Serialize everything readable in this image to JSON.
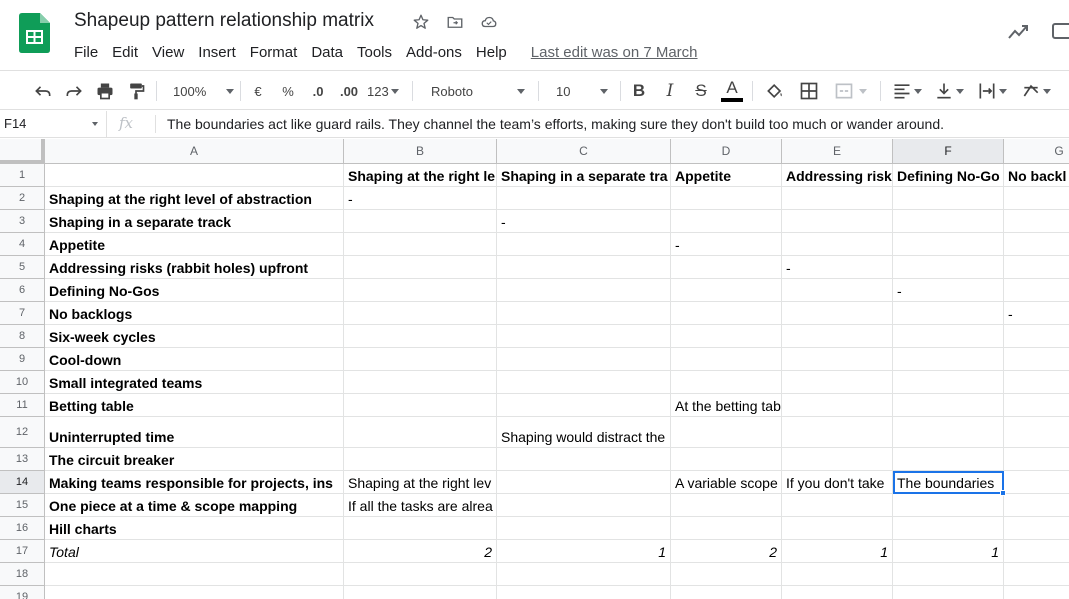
{
  "app": {
    "title": "Shapeup pattern relationship matrix",
    "last_edit": "Last edit was on 7 March",
    "menu": [
      "File",
      "Edit",
      "View",
      "Insert",
      "Format",
      "Data",
      "Tools",
      "Add-ons",
      "Help"
    ]
  },
  "toolbar": {
    "zoom": "100%",
    "currency": "€",
    "percent": "%",
    "decrease_decimal": ".0",
    "increase_decimal": ".00",
    "more_formats": "123",
    "font": "Roboto",
    "font_size": "10",
    "bold": "B",
    "italic": "I",
    "strike": "S",
    "text_color": "A"
  },
  "formula_bar": {
    "cell_ref": "F14",
    "fx": "fx",
    "content": "The boundaries act like guard rails. They channel the team’s efforts, making sure they don't build too much or wander around."
  },
  "colors": {
    "accent": "#1a73e8",
    "sheets_green": "#0f9d58"
  },
  "grid": {
    "columns": [
      "A",
      "B",
      "C",
      "D",
      "E",
      "F",
      "G"
    ],
    "rows": [
      "1",
      "2",
      "3",
      "4",
      "5",
      "6",
      "7",
      "8",
      "9",
      "10",
      "11",
      "12",
      "13",
      "14",
      "15",
      "16",
      "17",
      "18",
      "19"
    ],
    "header_row": [
      "",
      "Shaping at the right le",
      "Shaping in a separate tra",
      "Appetite",
      "Addressing risk",
      "Defining No-Go",
      "No backl"
    ],
    "row_labels": [
      "Shaping at the right level of abstraction",
      "Shaping in a separate track",
      "Appetite",
      "Addressing risks (rabbit holes) upfront",
      "Defining No-Gos",
      "No backlogs",
      "Six-week cycles",
      "Cool-down",
      "Small integrated teams",
      "Betting table",
      "Uninterrupted time",
      "The circuit breaker",
      "Making teams responsible for projects, ins",
      "One piece at a time & scope mapping",
      "Hill charts"
    ],
    "dashes": {
      "b2": "-",
      "c3": "-",
      "d4": "-",
      "e5": "-",
      "f6": "-",
      "g7": "-"
    },
    "notes": {
      "d11": "At the betting tab",
      "c12": "Shaping would distract the",
      "b14": "Shaping at the right lev",
      "d14": "A variable scope",
      "e14": "If you don't take",
      "f14": "The boundaries",
      "b15": "If all the tasks are alrea"
    },
    "total_label": "Total",
    "totals": {
      "b": "2",
      "c": "1",
      "d": "2",
      "e": "1",
      "f": "1"
    }
  }
}
